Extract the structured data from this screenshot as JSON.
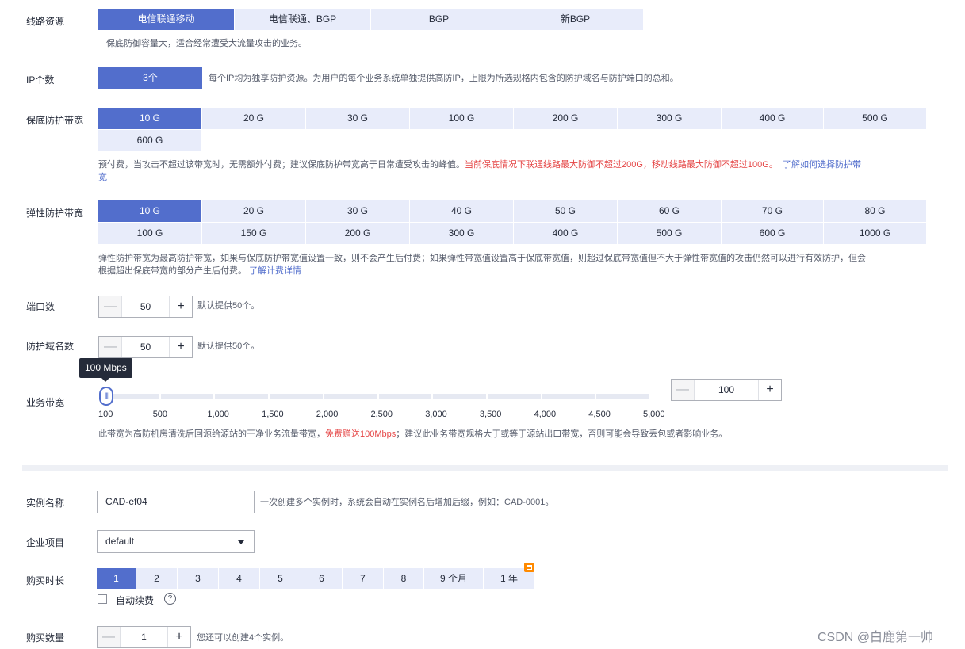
{
  "line": {
    "label": "线路资源",
    "options": [
      "电信联通移动",
      "电信联通、BGP",
      "BGP",
      "新BGP"
    ],
    "selected": "电信联通移动",
    "hint": "保底防御容量大，适合经常遭受大流量攻击的业务。"
  },
  "ip": {
    "label": "IP个数",
    "value": "3个",
    "hint": "每个IP均为独享防护资源。为用户的每个业务系统单独提供高防IP，上限为所选规格内包含的防护域名与防护端口的总和。"
  },
  "base_bw": {
    "label": "保底防护带宽",
    "options": [
      "10 G",
      "20 G",
      "30 G",
      "100 G",
      "200 G",
      "300 G",
      "400 G",
      "500 G",
      "600 G"
    ],
    "selected": "10 G",
    "hint_normal": "预付费，当攻击不超过该带宽时，无需额外付费；建议保底防护带宽高于日常遭受攻击的峰值。",
    "hint_red": "当前保底情况下联通线路最大防御不超过200G，移动线路最大防御不超过100G。",
    "hint_link_a": "了解如何选择防护带",
    "hint_link_b": "宽"
  },
  "elastic_bw": {
    "label": "弹性防护带宽",
    "options": [
      "10 G",
      "20 G",
      "30 G",
      "40 G",
      "50 G",
      "60 G",
      "70 G",
      "80 G",
      "100 G",
      "150 G",
      "200 G",
      "300 G",
      "400 G",
      "500 G",
      "600 G",
      "1000 G"
    ],
    "selected": "10 G",
    "hint_line1": "弹性防护带宽为最高防护带宽，如果与保底防护带宽值设置一致，则不会产生后付费；如果弹性带宽值设置高于保底带宽值，则超过保底带宽值但不大于弹性带宽值的攻击仍然可以进行有效防护，但会",
    "hint_line2": "根据超出保底带宽的部分产生后付费。",
    "hint_link": "了解计费详情"
  },
  "ports": {
    "label": "端口数",
    "value": "50",
    "hint": "默认提供50个。"
  },
  "domains": {
    "label": "防护域名数",
    "value": "50",
    "hint": "默认提供50个。"
  },
  "service_bw": {
    "label": "业务带宽",
    "tooltip": "100 Mbps",
    "value": "100",
    "slider_value": 100,
    "slider_min": 100,
    "slider_max": 5000,
    "ticks": [
      "100",
      "500",
      "1,000",
      "1,500",
      "2,000",
      "2,500",
      "3,000",
      "3,500",
      "4,000",
      "4,500",
      "5,000"
    ],
    "hint_a": "此带宽为高防机房清洗后回源给源站的干净业务流量带宽，",
    "hint_red": "免费赠送100Mbps",
    "hint_b": "；建议此业务带宽规格大于或等于源站出口带宽，否则可能会导致丢包或者影响业务。"
  },
  "instance": {
    "label": "实例名称",
    "value": "CAD-ef04",
    "hint": "一次创建多个实例时，系统会自动在实例名后增加后缀，例如：CAD-0001。"
  },
  "project": {
    "label": "企业项目",
    "value": "default"
  },
  "duration": {
    "label": "购买时长",
    "options": [
      "1",
      "2",
      "3",
      "4",
      "5",
      "6",
      "7",
      "8",
      "9 个月",
      "1 年"
    ],
    "selected": "1",
    "auto_renew": "自动续费",
    "help": "?"
  },
  "quantity": {
    "label": "购买数量",
    "value": "1",
    "hint": "您还可以创建4个实例。"
  },
  "watermark": "CSDN @白鹿第一帅",
  "colors": {
    "accent": "#526ecc",
    "segment_bg": "#e8ecfa",
    "warning": "#e54545",
    "promo": "#ff8a00"
  }
}
